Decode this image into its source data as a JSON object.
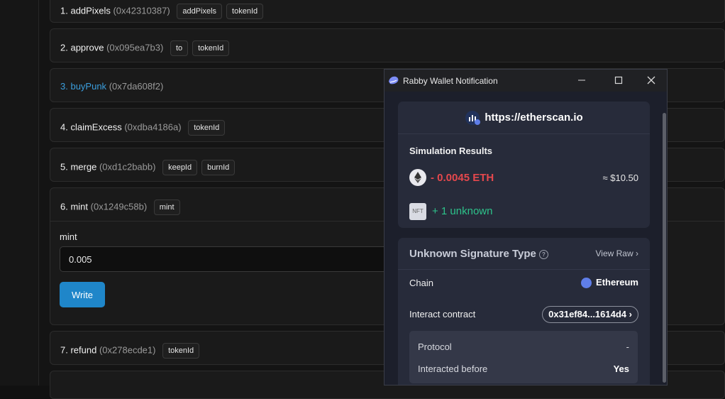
{
  "functions": [
    {
      "num": "1.",
      "name": "addPixels",
      "sig": "(0x42310387)",
      "params": [
        "addPixels",
        "tokenId"
      ]
    },
    {
      "num": "2.",
      "name": "approve",
      "sig": "(0x095ea7b3)",
      "params": [
        "to",
        "tokenId"
      ]
    },
    {
      "num": "3.",
      "name": "buyPunk",
      "sig": "(0x7da608f2)",
      "params": []
    },
    {
      "num": "4.",
      "name": "claimExcess",
      "sig": "(0xdba4186a)",
      "params": [
        "tokenId"
      ]
    },
    {
      "num": "5.",
      "name": "merge",
      "sig": "(0xd1c2babb)",
      "params": [
        "keepId",
        "burnId"
      ]
    },
    {
      "num": "6.",
      "name": "mint",
      "sig": "(0x1249c58b)",
      "params": [
        "mint"
      ]
    },
    {
      "num": "7.",
      "name": "refund",
      "sig": "(0x278ecde1)",
      "params": [
        "tokenId"
      ]
    }
  ],
  "mint_form": {
    "label": "mint",
    "value": "0.005",
    "write_label": "Write"
  },
  "rabby": {
    "window_title": "Rabby Wallet Notification",
    "site": "https://etherscan.io",
    "simulation_title": "Simulation Results",
    "eth_change": "- 0.0045 ETH",
    "usd_value": "≈ $10.50",
    "nft_badge": "NFT",
    "nft_change": "+ 1 unknown",
    "signature_title": "Unknown Signature Type",
    "view_raw": "View Raw",
    "chain_label": "Chain",
    "chain_value": "Ethereum",
    "interact_label": "Interact contract",
    "contract_addr": "0x31ef84...1614d4",
    "protocol_label": "Protocol",
    "protocol_value": "-",
    "interacted_label": "Interacted before",
    "interacted_value": "Yes",
    "colors": {
      "negative": "#e5484d",
      "positive": "#2dc28a",
      "accent": "#1f86c9"
    }
  }
}
